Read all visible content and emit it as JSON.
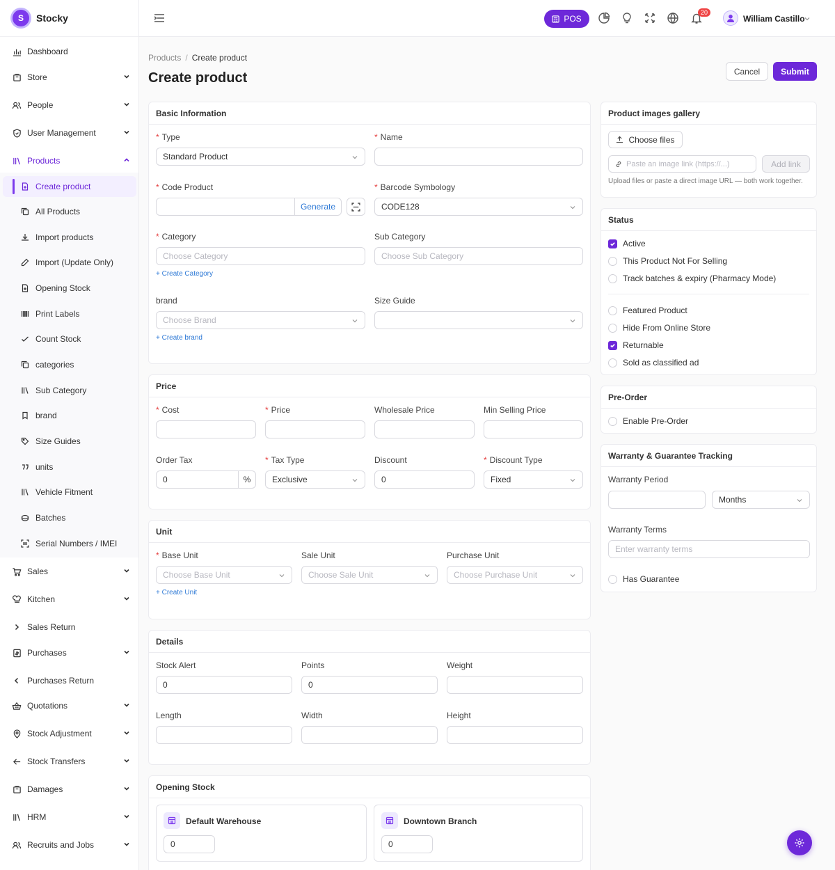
{
  "app": {
    "name": "Stocky",
    "logo_letter": "S",
    "accent": "#6d28d9"
  },
  "sidebar": {
    "items": [
      {
        "label": "Dashboard",
        "icon": "chart-bar-icon"
      },
      {
        "label": "Store",
        "icon": "store-icon"
      },
      {
        "label": "People",
        "icon": "people-icon"
      },
      {
        "label": "User Management",
        "icon": "shield-icon"
      },
      {
        "label": "Products",
        "icon": "books-icon"
      }
    ],
    "products_sub": [
      {
        "label": "Create product",
        "icon": "file-plus-icon"
      },
      {
        "label": "All Products",
        "icon": "copy-icon"
      },
      {
        "label": "Import products",
        "icon": "download-icon"
      },
      {
        "label": "Import (Update Only)",
        "icon": "pencil-icon"
      },
      {
        "label": "Opening Stock",
        "icon": "file-plus-icon"
      },
      {
        "label": "Print Labels",
        "icon": "barcode-icon"
      },
      {
        "label": "Count Stock",
        "icon": "check-icon"
      },
      {
        "label": "categories",
        "icon": "copy-icon"
      },
      {
        "label": "Sub Category",
        "icon": "books-icon"
      },
      {
        "label": "brand",
        "icon": "bookmark-icon"
      },
      {
        "label": "Size Guides",
        "icon": "tag-icon"
      },
      {
        "label": "units",
        "icon": "quote-icon"
      },
      {
        "label": "Vehicle Fitment",
        "icon": "books-icon"
      },
      {
        "label": "Batches",
        "icon": "cake-icon"
      },
      {
        "label": "Serial Numbers / IMEI",
        "icon": "scan-icon"
      }
    ],
    "lower_items": [
      {
        "label": "Sales",
        "icon": "cart-icon"
      },
      {
        "label": "Kitchen",
        "icon": "chef-hat-icon"
      },
      {
        "label": "Sales Return",
        "icon": "chevron-right-icon"
      },
      {
        "label": "Purchases",
        "icon": "receipt-icon"
      },
      {
        "label": "Purchases Return",
        "icon": "chevron-left-icon"
      },
      {
        "label": "Quotations",
        "icon": "basket-icon"
      },
      {
        "label": "Stock Adjustment",
        "icon": "map-pin-icon"
      },
      {
        "label": "Stock Transfers",
        "icon": "arrow-left-icon"
      },
      {
        "label": "Damages",
        "icon": "store-icon"
      },
      {
        "label": "HRM",
        "icon": "books-icon"
      },
      {
        "label": "Recruits and Jobs",
        "icon": "people-icon"
      }
    ]
  },
  "topbar": {
    "pos_label": "POS",
    "notification_count": "20",
    "user_name": "William Castillo"
  },
  "page": {
    "breadcrumb": [
      "Products",
      "Create product"
    ],
    "title": "Create product",
    "cancel_label": "Cancel",
    "submit_label": "Submit"
  },
  "basic": {
    "title": "Basic Information",
    "type_label": "Type",
    "type_value": "Standard Product",
    "name_label": "Name",
    "code_label": "Code Product",
    "generate_label": "Generate",
    "barcode_label": "Barcode Symbology",
    "barcode_value": "CODE128",
    "category_label": "Category",
    "category_ph": "Choose Category",
    "subcat_label": "Sub Category",
    "subcat_ph": "Choose Sub Category",
    "create_category": "+ Create Category",
    "brand_label": "brand",
    "brand_ph": "Choose Brand",
    "size_label": "Size Guide",
    "create_brand": "+ Create brand"
  },
  "price": {
    "title": "Price",
    "cost_label": "Cost",
    "price_label": "Price",
    "wholesale_label": "Wholesale Price",
    "min_label": "Min Selling Price",
    "tax_label": "Order Tax",
    "tax_value": "0",
    "tax_unit": "%",
    "taxtype_label": "Tax Type",
    "taxtype_value": "Exclusive",
    "discount_label": "Discount",
    "discount_value": "0",
    "disctype_label": "Discount Type",
    "disctype_value": "Fixed"
  },
  "unit": {
    "title": "Unit",
    "base_label": "Base Unit",
    "base_ph": "Choose Base Unit",
    "sale_label": "Sale Unit",
    "sale_ph": "Choose Sale Unit",
    "purchase_label": "Purchase Unit",
    "purchase_ph": "Choose Purchase Unit",
    "create_unit": "+ Create Unit"
  },
  "details": {
    "title": "Details",
    "stock_alert_label": "Stock Alert",
    "stock_alert_value": "0",
    "points_label": "Points",
    "points_value": "0",
    "weight_label": "Weight",
    "length_label": "Length",
    "width_label": "Width",
    "height_label": "Height"
  },
  "opening": {
    "title": "Opening Stock",
    "warehouses": [
      {
        "name": "Default Warehouse",
        "value": "0"
      },
      {
        "name": "Downtown Branch",
        "value": "0"
      }
    ]
  },
  "gallery": {
    "title": "Product images gallery",
    "choose_files": "Choose files",
    "link_ph": "Paste an image link (https://...)",
    "add_link": "Add link",
    "hint": "Upload files or paste a direct image URL — both work together."
  },
  "status": {
    "title": "Status",
    "options": [
      {
        "label": "Active",
        "checked": true
      },
      {
        "label": "This Product Not For Selling",
        "checked": false
      },
      {
        "label": "Track batches & expiry (Pharmacy Mode)",
        "checked": false
      },
      {
        "label": "Featured Product",
        "checked": false
      },
      {
        "label": "Hide From Online Store",
        "checked": false
      },
      {
        "label": "Returnable",
        "checked": true
      },
      {
        "label": "Sold as classified ad",
        "checked": false
      }
    ]
  },
  "preorder": {
    "title": "Pre-Order",
    "enable_label": "Enable Pre-Order"
  },
  "warranty": {
    "title": "Warranty & Guarantee Tracking",
    "period_label": "Warranty Period",
    "period_unit": "Months",
    "terms_label": "Warranty Terms",
    "terms_ph": "Enter warranty terms",
    "guarantee_label": "Has Guarantee"
  }
}
